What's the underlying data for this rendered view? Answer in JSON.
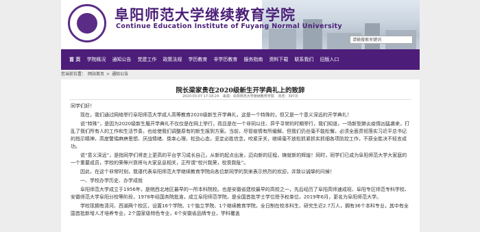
{
  "header": {
    "title_cn": "阜阳师范大学继续教育学院",
    "title_en": "Continue Education Institute of Fuyang Normal University",
    "search_placeholder": "请输搜索关键词"
  },
  "nav": {
    "items": [
      "首 页",
      "学院概况",
      "通知公告",
      "党建工作",
      "政策法规",
      "学历教育",
      "非学历教育",
      "服务指南",
      "资料下载",
      "联系我们",
      "旧版入口"
    ]
  },
  "breadcrumb": {
    "prefix": "您当前位置：",
    "home": "网站首页",
    "sep1": ">",
    "section": "通知公告"
  },
  "article": {
    "title": "院长梁家贵在2020级新生开学典礼上的致辞",
    "meta_date": "2020-03-07 17:18:24",
    "meta_source": "来源：阜阳师范大学继续教育学院",
    "meta_views": "浏览：397次",
    "greeting": "同学们好！",
    "p1": "现在，我们通过网络举行阜阳师范大学成人高等教育2020级新生开学典礼，这是一个特殊的，但又是一个意义深远的开学典礼！",
    "p2": "说“特殊”，是因为2020级新生履开学典礼不仅仅是在网上举行，而且是在一个非同以往、异乎寻常的时期举行，我们知道，一场新型肺炎疫情凶猛袭来，打乱了我们所有人的工作和生活节奏，也给使我们调整原有的新生报到方案。当前，尽管疫情有所缓解，但我们仍丝毫不能松懈，必须全面贯彻落实习近平总书记的指示精神，高度警惕麻痹思想、厌战情绪、侥幸心理、松劲心态，坚定必胜信念，咬紧牙关，继续毫不放松抓紧抓实抓细各项防控工作，不获全胜决不轻言成功。",
    "p3": "说“意义深远”，是指同学们将走上更高的平台学习成长自己，从新的起点出发，迈向新的征程，铸就新的辉煌！同时，同学们已成为阜阳师范大学大家庭的一个重要成员，学校的荣辱兴衰将与大家息息相关，正所谓“校兴我荣，校衰我耻”。",
    "p4": "因此，在这个非常时刻，我谨代表阜阳师范大学继续教育学院向各位新同学的到来表示热烈的欢迎，并致以诚挚的问候！",
    "h1": "一、学校办学历史、办学成就",
    "p5": "阜阳师范大学成立于1956年，是皖西北地区最早的一所本科院校。也是安徽省建校最早的高校之一，先后经历了阜阳高师速成班、阜阳专区师范专科学校、安徽师范大学阜阳分校等阶段，1978年经国务院批准，成立阜阳师范学院，是全国首批学士学位授予权单位，2019年6月，更名为阜阳师范大学。",
    "p6": "学校现拥有清河、西湖两个校区，设置16个学院、1个独立学院、1个继续教育学院，全日制在校本科生、研究生近2.7万人，拥有36个本科专业，其中有全国首批新增人才培养专业，2个国家级特色专业，6个安徽省品牌专业，学科覆盖"
  }
}
